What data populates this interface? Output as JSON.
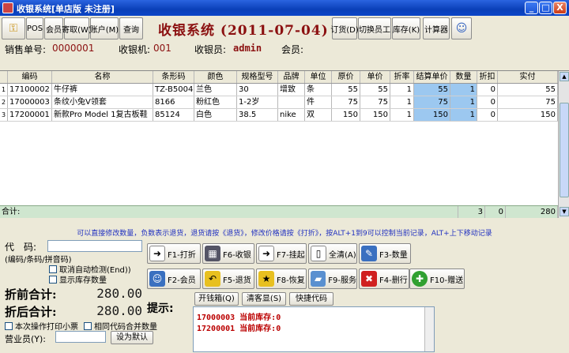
{
  "window": {
    "title": "收银系统[单店版 未注册]",
    "min": "_",
    "max": "□",
    "close": "X"
  },
  "toolbar": {
    "pos": "POS",
    "member": "会员",
    "register": "寄取(W)",
    "account": "账户(M)",
    "query": "查询",
    "app_name": "收银系统 (2011-07-04)",
    "order": "订货(D)",
    "switch": "切换员工",
    "stock": "库存(K)",
    "calculator": "计算器"
  },
  "info": {
    "order_no_label": "销售单号:",
    "order_no": "0000001",
    "register_label": "收银机:",
    "register": "001",
    "cashier_label": "收银员:",
    "cashier": "admin",
    "member_label": "会员:"
  },
  "grid": {
    "headers": [
      "编码",
      "名称",
      "条形码",
      "颜色",
      "规格型号",
      "品牌",
      "单位",
      "原价",
      "单价",
      "折率",
      "结算单价",
      "数量",
      "折扣",
      "实付"
    ],
    "rows": [
      {
        "idx": "1",
        "code": "17100002",
        "name": "牛仔裤",
        "barcode": "TZ-B5004",
        "color": "兰色",
        "spec": "30",
        "brand": "增致",
        "unit": "条",
        "orig": "55",
        "price": "55",
        "rate": "1",
        "settle": "55",
        "qty": "1",
        "disc": "0",
        "paid": "55"
      },
      {
        "idx": "2",
        "code": "17000003",
        "name": "条纹小兔V领套",
        "barcode": "8166",
        "color": "粉红色",
        "spec": "1-2岁",
        "brand": "",
        "unit": "件",
        "orig": "75",
        "price": "75",
        "rate": "1",
        "settle": "75",
        "qty": "1",
        "disc": "0",
        "paid": "75"
      },
      {
        "idx": "3",
        "code": "17200001",
        "name": "新款Pro Model 1复古板鞋",
        "barcode": "85124",
        "color": "白色",
        "spec": "38.5",
        "brand": "nike",
        "unit": "双",
        "orig": "150",
        "price": "150",
        "rate": "1",
        "settle": "150",
        "qty": "1",
        "disc": "0",
        "paid": "150"
      }
    ],
    "total_label": "合计:",
    "total_qty": "3",
    "total_disc": "0",
    "total_paid": "280"
  },
  "notice": "可以直接修改数量，负数表示退货，退货请按《退货》，修改价格请按《打折》，按ALT+1到9可以控制当前记录，ALT+上下移动记录",
  "bottom": {
    "code_label": "代　码:",
    "code_sub": "(编码/条码/拼音码)",
    "auto_detect": "取消自动检测(End))",
    "show_stock": "显示库存数量",
    "before_label": "折前合计:",
    "before_total": "280.00",
    "after_label": "折后合计:",
    "after_total": "280.00",
    "print_receipt": "本次操作打印小票",
    "merge_same": "相同代码合并数量",
    "sales_label": "营业员(Y):",
    "set_default": "设为默认"
  },
  "fn": {
    "f1": "F1-打折",
    "f6": "F6-收银",
    "f7": "F7-挂起",
    "clear": "全清(A)",
    "f3": "F3-数量",
    "f2": "F2-会员",
    "f5": "F5-退货",
    "f8": "F8-恢复",
    "f9": "F9-服务",
    "f4": "F4-删行",
    "f10": "F10-赠送"
  },
  "hint": {
    "label": "提示:",
    "open_drawer": "开钱箱(Q)",
    "clear_screen": "清客显(S)",
    "quick_code": "快捷代码",
    "lines": [
      "17000003 当前库存:0",
      "17200001 当前库存:0"
    ]
  }
}
